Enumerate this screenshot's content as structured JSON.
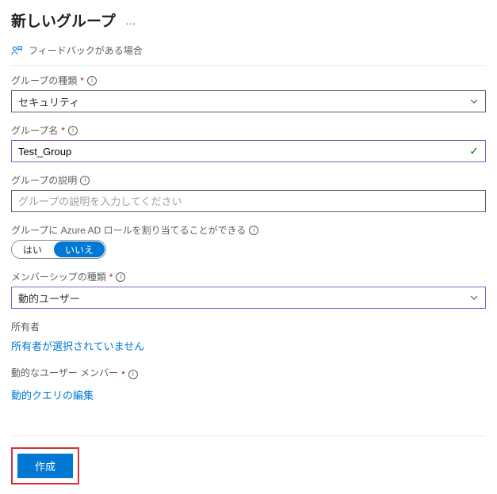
{
  "header": {
    "title": "新しいグループ",
    "more": "…"
  },
  "feedback": {
    "label": "フィードバックがある場合"
  },
  "fields": {
    "group_type": {
      "label": "グループの種類",
      "value": "セキュリティ",
      "required": true
    },
    "group_name": {
      "label": "グループ名",
      "value": "Test_Group",
      "required": true
    },
    "group_description": {
      "label": "グループの説明",
      "placeholder": "グループの説明を入力してください"
    },
    "azure_ad_role": {
      "label": "グループに Azure AD ロールを割り当てることができる",
      "option_yes": "はい",
      "option_no": "いいえ",
      "selected": "no"
    },
    "membership_type": {
      "label": "メンバーシップの種類",
      "value": "動的ユーザー",
      "required": true
    },
    "owners": {
      "label": "所有者",
      "link": "所有者が選択されていません"
    },
    "dynamic_members": {
      "label": "動的なユーザー メンバー",
      "required": true,
      "link": "動的クエリの編集"
    }
  },
  "footer": {
    "create_button": "作成"
  }
}
